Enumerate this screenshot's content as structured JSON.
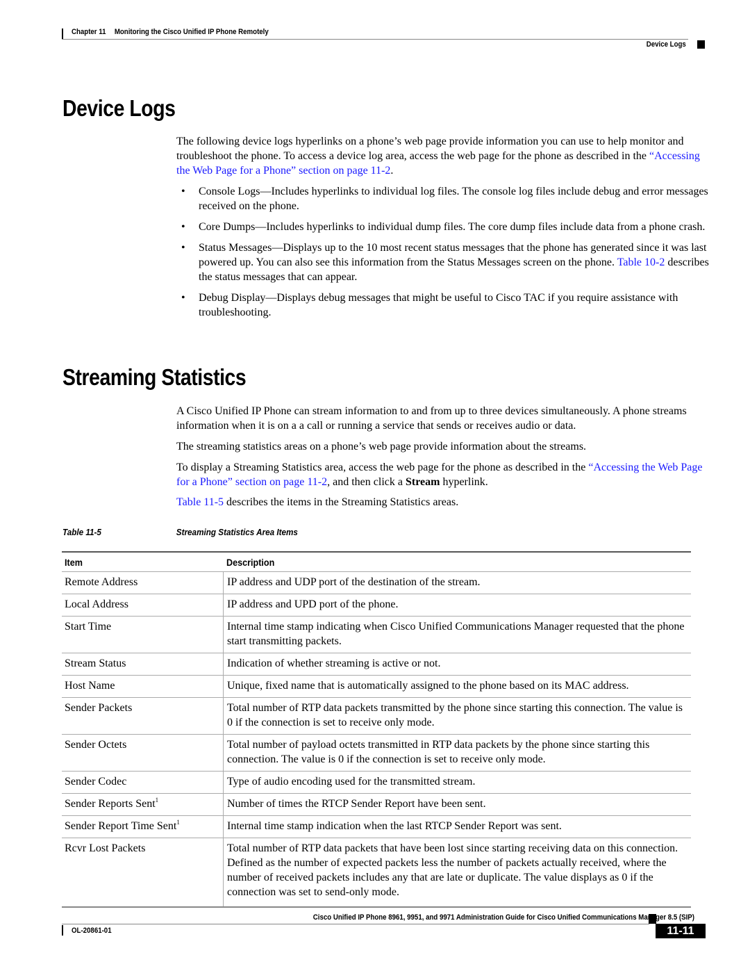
{
  "header": {
    "chapter_label": "Chapter 11",
    "chapter_title": "Monitoring the Cisco Unified IP Phone Remotely",
    "section": "Device Logs"
  },
  "device_logs": {
    "heading": "Device Logs",
    "intro_text": "The following device logs hyperlinks on a phone’s web page provide information you can use to help monitor and troubleshoot the phone. To access a device log area, access the web page for the phone as described in the ",
    "intro_link": "“Accessing the Web Page for a Phone” section on page 11-2",
    "intro_end": ".",
    "bullet_glyph": "•",
    "bullets": [
      {
        "text": "Console Logs—Includes hyperlinks to individual log files. The console log files include debug and error messages received on the phone."
      },
      {
        "text": "Core Dumps—Includes hyperlinks to individual dump files. The core dump files include data from a phone crash."
      },
      {
        "text_before": "Status Messages—Displays up to the 10 most recent status messages that the phone has generated since it was last powered up. You can also see this information from the Status Messages screen on the phone. ",
        "link": "Table 10-2",
        "text_after": " describes the status messages that can appear."
      },
      {
        "text": "Debug Display—Displays debug messages that might be useful to Cisco TAC if you require assistance with troubleshooting."
      }
    ]
  },
  "streaming": {
    "heading": "Streaming Statistics",
    "para1": "A Cisco Unified IP Phone can stream information to and from up to three devices simultaneously. A phone streams information when it is on a a call or running a service that sends or receives audio or data.",
    "para2": "The streaming statistics areas on a phone’s web page provide information about the streams.",
    "para3_text": "To display a Streaming Statistics area, access the web page for the phone as described in the ",
    "para3_link": "“Accessing the Web Page for a Phone” section on page 11-2",
    "para3_mid": ", and then click a ",
    "para3_bold": "Stream",
    "para3_end": " hyperlink.",
    "para4_link": "Table 11-5",
    "para4_text": " describes the items in the Streaming Statistics areas."
  },
  "table": {
    "caption_num": "Table 11-5",
    "caption_title": "Streaming Statistics Area Items",
    "columns": [
      "Item",
      "Description"
    ],
    "rows": [
      {
        "item": "Remote Address",
        "sup": "",
        "description": "IP address and UDP port of the destination of the stream."
      },
      {
        "item": "Local Address",
        "sup": "",
        "description": "IP address and UPD port of the phone."
      },
      {
        "item": "Start Time",
        "sup": "",
        "description": "Internal time stamp indicating when Cisco Unified Communications Manager requested that the phone start transmitting packets."
      },
      {
        "item": "Stream Status",
        "sup": "",
        "description": "Indication of whether streaming is active or not."
      },
      {
        "item": "Host Name",
        "sup": "",
        "description": "Unique, fixed name that is automatically assigned to the phone based on its MAC address."
      },
      {
        "item": "Sender Packets",
        "sup": "",
        "description": "Total number of RTP data packets transmitted by the phone since starting this connection. The value is 0 if the connection is set to receive only mode."
      },
      {
        "item": "Sender Octets",
        "sup": "",
        "description": "Total number of payload octets transmitted in RTP data packets by the phone since starting this connection. The value is 0 if the connection is set to receive only mode."
      },
      {
        "item": "Sender Codec",
        "sup": "",
        "description": "Type of audio encoding used for the transmitted stream."
      },
      {
        "item": "Sender Reports Sent",
        "sup": "1",
        "description": "Number of times the RTCP Sender Report have been sent."
      },
      {
        "item": "Sender Report Time Sent",
        "sup": "1",
        "description": "Internal time stamp indication when the last RTCP Sender Report was sent."
      },
      {
        "item": "Rcvr Lost Packets",
        "sup": "",
        "description": "Total number of RTP data packets that have been lost since starting receiving data on this connection. Defined as the number of expected packets less the number of packets actually received, where the number of received packets includes any that are late or duplicate. The value displays as 0 if the connection was set to send-only mode."
      }
    ]
  },
  "footer": {
    "guide_title": "Cisco Unified IP Phone 8961, 9951, and 9971 Administration Guide for Cisco Unified Communications Manager 8.5 (SIP)",
    "doc_number": "OL-20861-01",
    "page_number": "11-11"
  }
}
